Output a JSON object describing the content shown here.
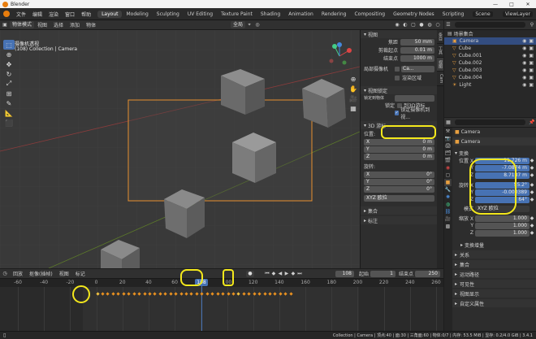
{
  "titlebar": {
    "title": "Blender"
  },
  "menu": {
    "items": [
      "文件",
      "编辑",
      "渲染",
      "窗口",
      "帮助"
    ]
  },
  "workspaces": {
    "tabs": [
      "Layout",
      "Modeling",
      "Sculpting",
      "UV Editing",
      "Texture Paint",
      "Shading",
      "Animation",
      "Rendering",
      "Compositing",
      "Geometry Nodes",
      "Scripting"
    ],
    "active": "Layout"
  },
  "scene": {
    "label": "Scene",
    "viewlayer": "ViewLayer"
  },
  "viewport": {
    "mode": "物体模式",
    "header_items": [
      "视图",
      "选择",
      "添加",
      "物体"
    ],
    "global": "全局",
    "overlay_title": "摄像机透视",
    "overlay_sub": "(108) Collection | Camera"
  },
  "npanel": {
    "tabs": [
      "条目",
      "工具",
      "视图",
      "Cam"
    ],
    "view_header": "视图",
    "focal_label": "焦距",
    "focal_value": "50 mm",
    "clip_start_label": "剪裁起点",
    "clip_start_value": "0.01 m",
    "clip_end_label": "结束点",
    "clip_end_value": "1000 m",
    "local_cam_label": "局部摄像机",
    "local_cam_value": "Ca...",
    "render_region": "渲染区域",
    "view_lock_header": "视图锁定",
    "lock_to_obj_label": "锁定到物体",
    "lock_label": "锁定",
    "lock_3d_cursor": "到3D游标",
    "lock_cam_view": "锁定摄像机到视...",
    "cursor_header": "3D 游标",
    "location_label": "位置:",
    "loc_x": "0 m",
    "loc_y": "0 m",
    "loc_z": "0 m",
    "rotation_label": "旋转:",
    "rot_x": "0°",
    "rot_y": "0°",
    "rot_z": "0°",
    "rot_mode": "XYZ 欧拉",
    "collection_header": "集合",
    "annotation_header": "标注"
  },
  "outliner": {
    "header": "场景集合",
    "items": [
      {
        "name": "Camera",
        "selected": true,
        "icon": "camera-icon"
      },
      {
        "name": "Cube",
        "selected": false,
        "icon": "mesh-icon"
      },
      {
        "name": "Cube.001",
        "selected": false,
        "icon": "mesh-icon"
      },
      {
        "name": "Cube.002",
        "selected": false,
        "icon": "mesh-icon"
      },
      {
        "name": "Cube.003",
        "selected": false,
        "icon": "mesh-icon"
      },
      {
        "name": "Cube.004",
        "selected": false,
        "icon": "mesh-icon"
      },
      {
        "name": "Light",
        "selected": false,
        "icon": "light-icon"
      }
    ]
  },
  "properties": {
    "object_name": "Camera",
    "object_sub": "Camera",
    "transform_header": "变换",
    "location_label": "位置 X",
    "loc_x": "11.726 m",
    "loc_y": "-7.0874 m",
    "loc_z": "8.7187 m",
    "rotation_label": "旋转 X",
    "rot_x": "55.2°",
    "rot_y": "-0.000389",
    "rot_z": "64°",
    "mode_label": "模式",
    "mode_value": "XYZ 欧拉",
    "scale_label": "缩放 X",
    "scale_x": "1.000",
    "scale_y": "1.000",
    "scale_z": "1.000",
    "y_label": "Y",
    "z_label": "Z",
    "delta_header": "变换增量",
    "sections": [
      "关系",
      "集合",
      "运动路径",
      "可见性",
      "视图显示",
      "自定义属性"
    ]
  },
  "timeline": {
    "playback": "回放",
    "keying": "抠像(插帧)",
    "view": "视图",
    "marker": "标记",
    "current_frame": "108",
    "start_label": "起始",
    "start_value": "1",
    "end_label": "结束点",
    "end_value": "250",
    "ticks": [
      "-60",
      "-40",
      "-20",
      "0",
      "20",
      "40",
      "60",
      "80",
      "100",
      "108",
      "120",
      "140",
      "160",
      "180",
      "200",
      "220",
      "240",
      "260"
    ]
  },
  "statusbar": {
    "info": "Collection | Camera | 顶点:40 | 面:30 | 三角面:60 | 物体:0/7 | 内存: 53.5 MiB | 显存: 0.2/4.0 GiB | 3.4.1"
  },
  "colors": {
    "accent": "#4772b3",
    "annotation": "#f4e81c",
    "camera_frame": "#e6902e",
    "selected": "#334d80"
  }
}
